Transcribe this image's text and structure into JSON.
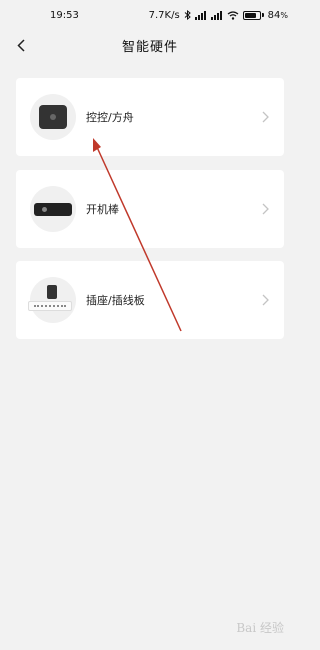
{
  "status_bar": {
    "time": "19:53",
    "network_speed": "7.7K/s",
    "battery": "84",
    "battery_level": 0.84,
    "icons": [
      "bluetooth-icon",
      "signal-icon",
      "signal-icon",
      "wifi-icon",
      "battery-icon"
    ]
  },
  "header": {
    "title": "智能硬件",
    "back_icon": "chevron-left-icon"
  },
  "devices": [
    {
      "label": "控控/方舟",
      "icon": "kongkong-device-icon"
    },
    {
      "label": "开机棒",
      "icon": "power-stick-device-icon"
    },
    {
      "label": "插座/插线板",
      "icon": "power-strip-device-icon"
    }
  ],
  "watermark": "Bai 经验",
  "colors": {
    "background": "#f2f2f2",
    "card": "#ffffff",
    "annotation_arrow": "#c0392b"
  }
}
